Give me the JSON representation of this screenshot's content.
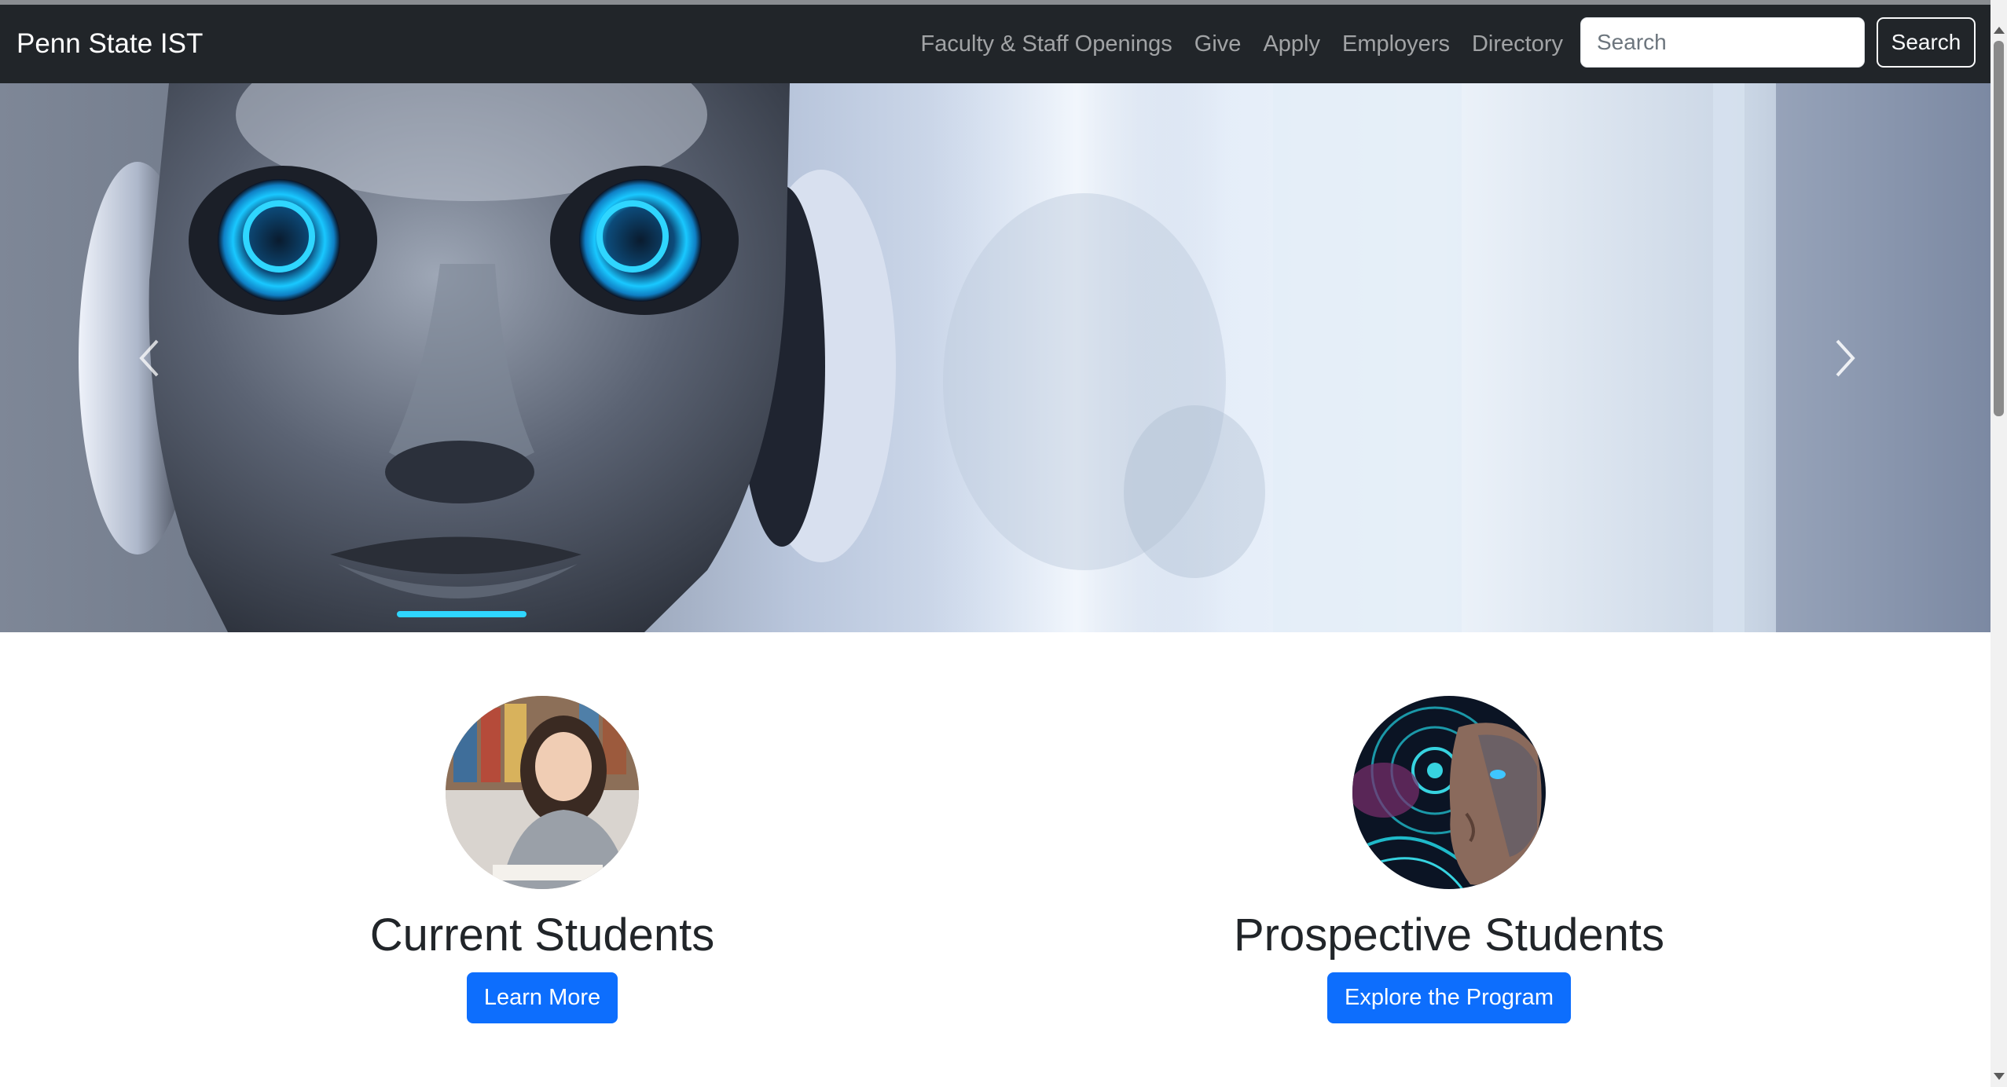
{
  "navbar": {
    "brand": "Penn State IST",
    "links": [
      {
        "label": "Faculty & Staff Openings"
      },
      {
        "label": "Give"
      },
      {
        "label": "Apply"
      },
      {
        "label": "Employers"
      },
      {
        "label": "Directory"
      }
    ],
    "search_placeholder": "Search",
    "search_button": "Search"
  },
  "hero": {
    "image": "robot-face-photo",
    "prev_icon": "chevron-left-icon",
    "next_icon": "chevron-right-icon"
  },
  "sections": [
    {
      "title": "Current Students",
      "button": "Learn More",
      "image": "student-in-library-photo"
    },
    {
      "title": "Prospective Students",
      "button": "Explore the Program",
      "image": "cyborg-face-photo"
    }
  ],
  "colors": {
    "navbar_bg": "#212529",
    "primary": "#0d6efd",
    "nav_link": "#9a9da2",
    "robot_eye": "#19c8ff"
  }
}
